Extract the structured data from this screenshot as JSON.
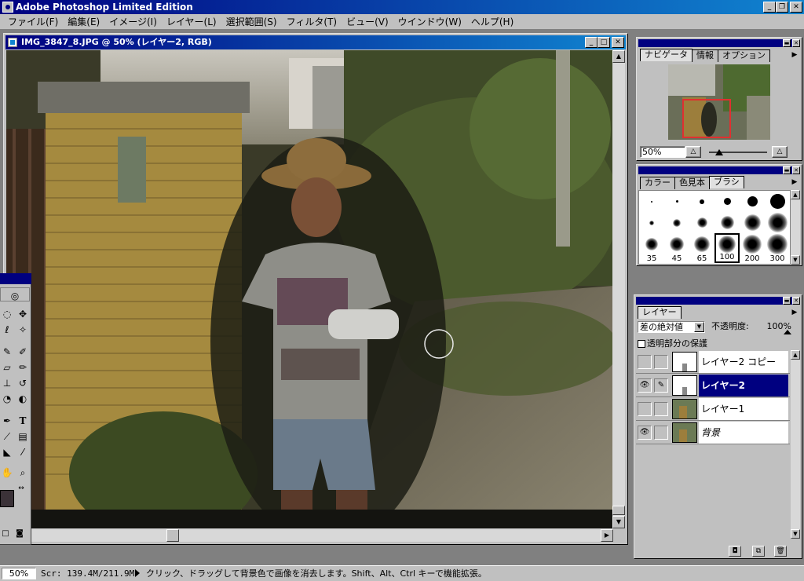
{
  "app": {
    "title": "Adobe Photoshop Limited Edition",
    "window_buttons": [
      "_",
      "❐",
      "✕"
    ]
  },
  "menu": [
    "ファイル(F)",
    "編集(E)",
    "イメージ(I)",
    "レイヤー(L)",
    "選択範囲(S)",
    "フィルタ(T)",
    "ビュー(V)",
    "ウインドウ(W)",
    "ヘルプ(H)"
  ],
  "document": {
    "title": "IMG_3847_8.JPG @ 50% (レイヤー2, RGB)",
    "window_buttons": [
      "_",
      "□",
      "✕"
    ]
  },
  "navigator": {
    "tabs": [
      "ナビゲータ",
      "情報",
      "オプション"
    ],
    "zoom": "50%"
  },
  "brushes": {
    "tabs": [
      "カラー",
      "色見本",
      "ブラシ"
    ],
    "size_labels": [
      "35",
      "45",
      "65",
      "100",
      "200",
      "300"
    ]
  },
  "layers": {
    "tab": "レイヤー",
    "blend_mode": "差の絶対値",
    "opacity_label": "不透明度:",
    "opacity_value": "100%",
    "preserve_label": "透明部分の保護",
    "items": [
      {
        "name": "レイヤー2 コピー",
        "visible": false,
        "selected": false
      },
      {
        "name": "レイヤー2",
        "visible": true,
        "selected": true
      },
      {
        "name": "レイヤー1",
        "visible": false,
        "selected": false
      },
      {
        "name": "背景",
        "visible": true,
        "selected": false
      }
    ]
  },
  "status": {
    "zoom": "50%",
    "scratch": "Scr: 139.4M/211.9M",
    "message": "クリック、ドラッグして背景色で画像を消去します。Shift、Alt、Ctrl キーで機能拡張。"
  },
  "colors": {
    "title_bar": "#000080",
    "selection": "#000080",
    "nav_view_rect": "#e03030",
    "foreground_swatch": "#3b3238",
    "background_swatch": "#ffffff"
  }
}
